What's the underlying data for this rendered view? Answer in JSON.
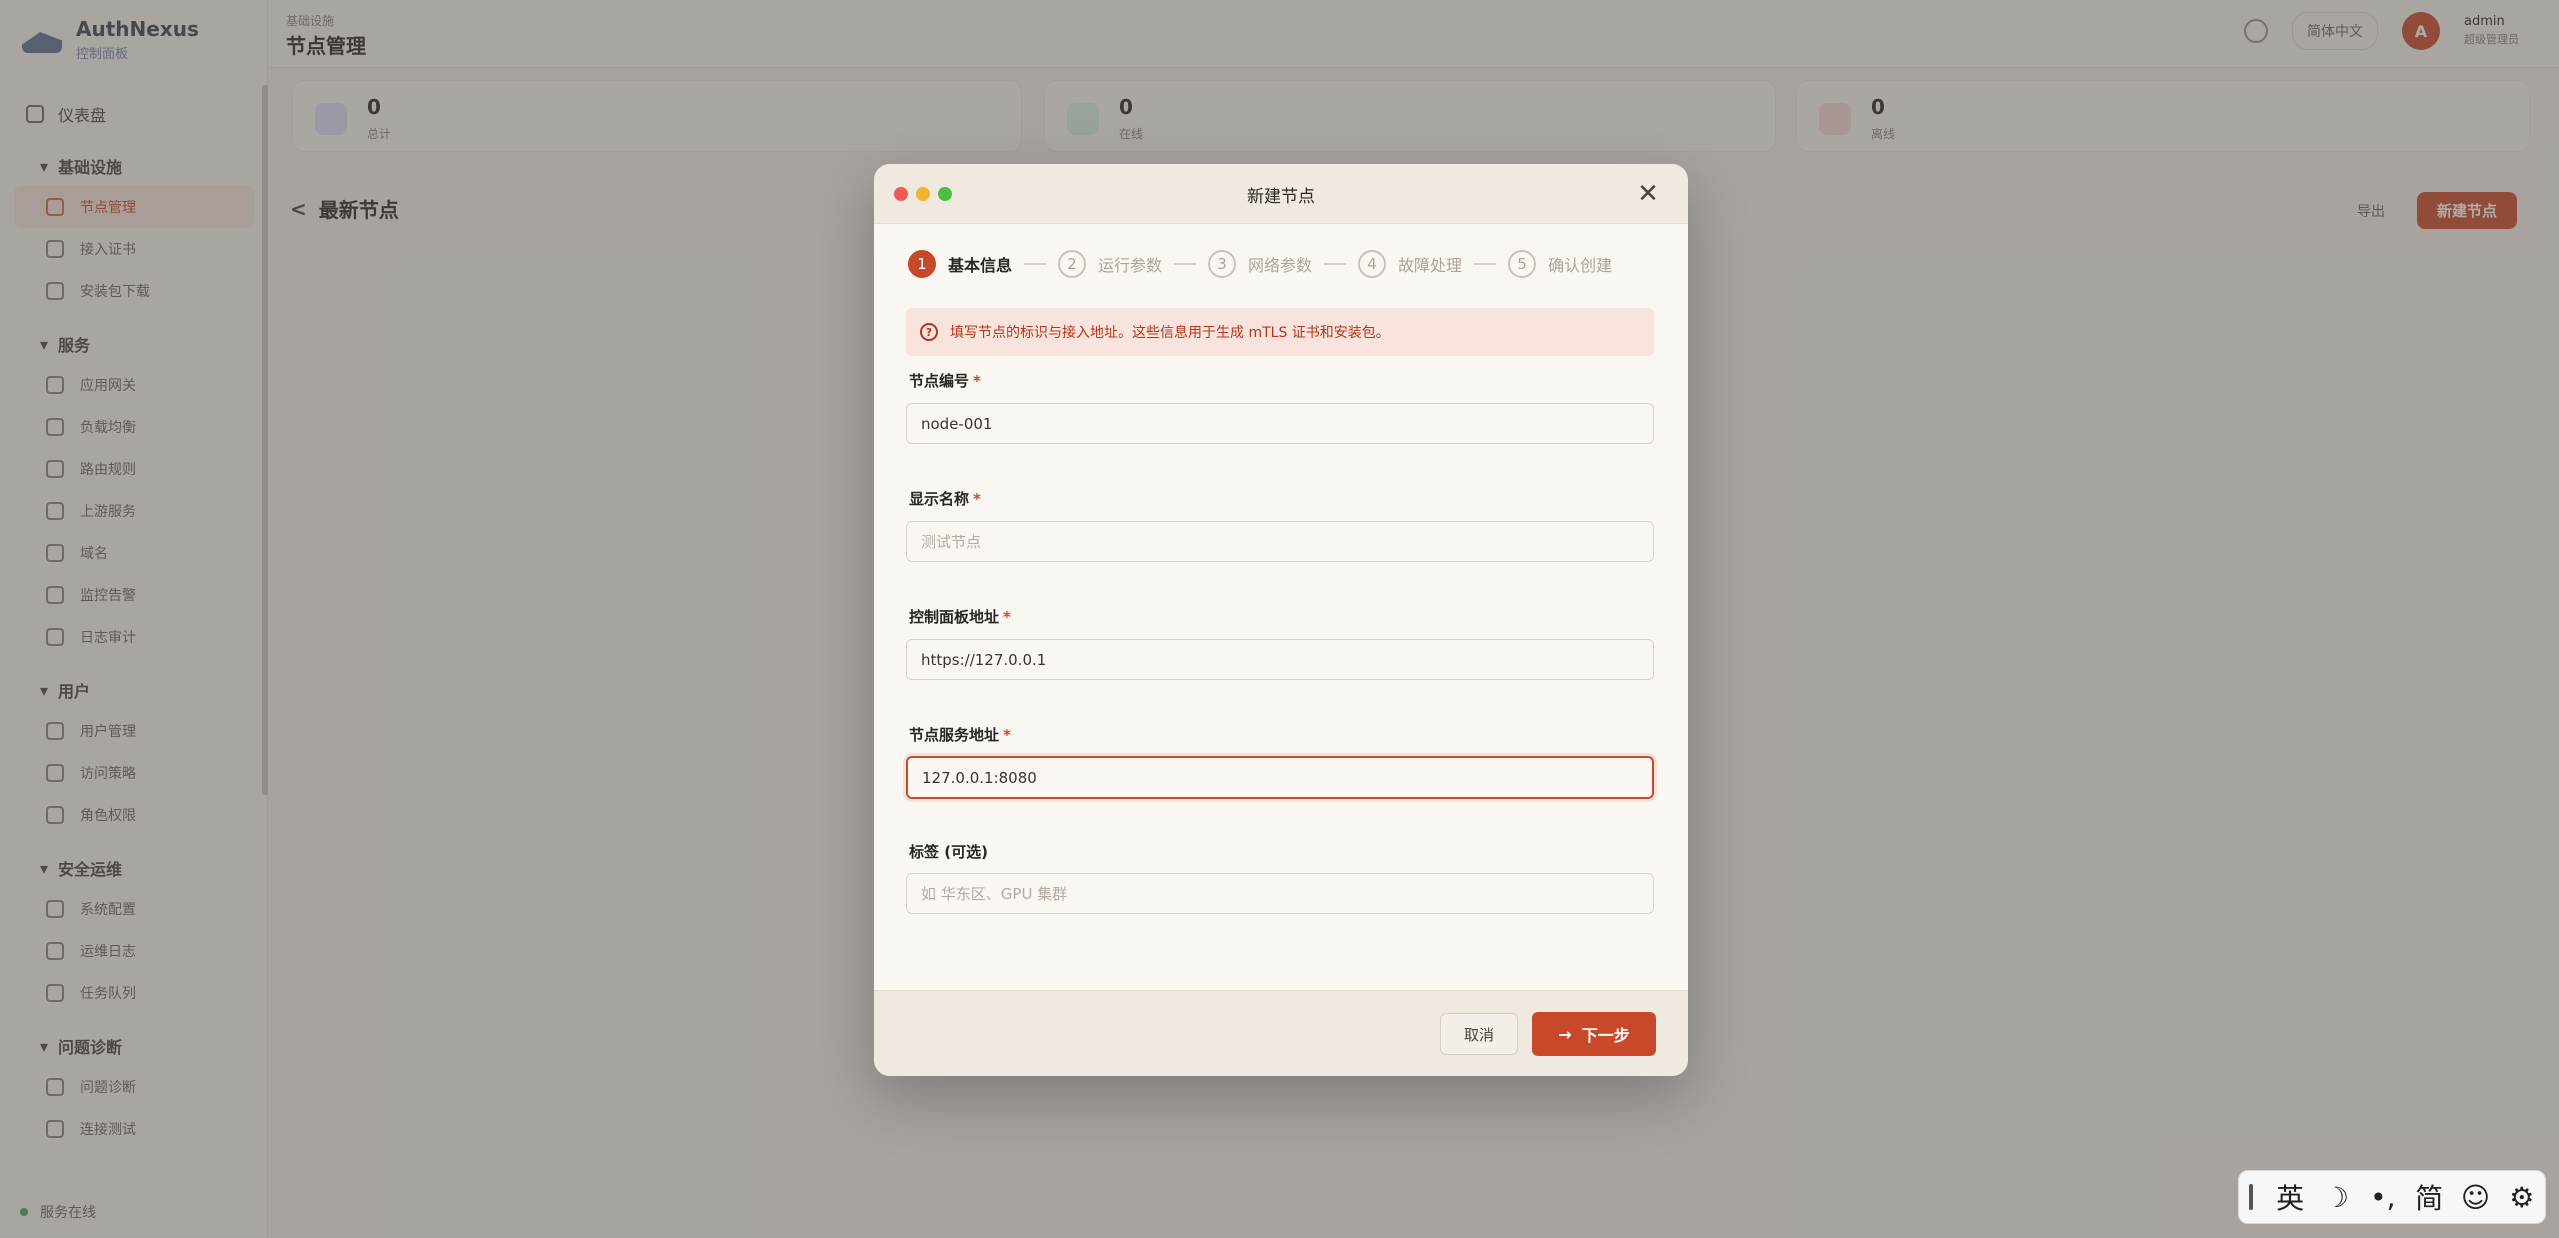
{
  "app": {
    "brand_title": "AuthNexus",
    "brand_sub": "控制面板"
  },
  "sidebar": {
    "top": {
      "label": "仪表盘"
    },
    "groups": [
      {
        "label": "基础设施",
        "items": [
          {
            "label": "节点管理",
            "active": true
          },
          {
            "label": "接入证书"
          },
          {
            "label": "安装包下载"
          }
        ]
      },
      {
        "label": "服务",
        "items": [
          {
            "label": "应用网关"
          },
          {
            "label": "负载均衡"
          },
          {
            "label": "路由规则"
          },
          {
            "label": "上游服务"
          },
          {
            "label": "域名"
          },
          {
            "label": "监控告警"
          },
          {
            "label": "日志审计"
          }
        ]
      },
      {
        "label": "用户",
        "items": [
          {
            "label": "用户管理"
          },
          {
            "label": "访问策略"
          },
          {
            "label": "角色权限"
          }
        ]
      },
      {
        "label": "安全运维",
        "items": [
          {
            "label": "系统配置"
          },
          {
            "label": "运维日志"
          },
          {
            "label": "任务队列"
          }
        ]
      },
      {
        "label": "问题诊断",
        "items": [
          {
            "label": "问题诊断"
          },
          {
            "label": "连接测试"
          }
        ]
      }
    ],
    "footer_status": "服务在线"
  },
  "topbar": {
    "crumb_small": "基础设施",
    "title": "节点管理",
    "lang": "简体中文",
    "avatar_letter": "A",
    "user_name": "admin",
    "user_role": "超级管理员"
  },
  "stats": [
    {
      "value": "0",
      "label": "总计",
      "color": "#6b6fd4"
    },
    {
      "value": "0",
      "label": "在线",
      "color": "#5db88a"
    },
    {
      "value": "0",
      "label": "离线",
      "color": "#d55a5a"
    }
  ],
  "section": {
    "title": "最新节点",
    "ghost_action": "导出",
    "primary_action": "新建节点"
  },
  "modal": {
    "title": "新建节点",
    "steps": [
      {
        "num": "1",
        "label": "基本信息",
        "active": true
      },
      {
        "num": "2",
        "label": "运行参数"
      },
      {
        "num": "3",
        "label": "网络参数"
      },
      {
        "num": "4",
        "label": "故障处理"
      },
      {
        "num": "5",
        "label": "确认创建"
      }
    ],
    "alert": "填写节点的标识与接入地址。这些信息用于生成 mTLS 证书和安装包。",
    "fields": {
      "node_id": {
        "label": "节点编号",
        "required": "*",
        "value": "node-001",
        "placeholder": ""
      },
      "display_name": {
        "label": "显示名称",
        "required": "*",
        "value": "",
        "placeholder": "测试节点"
      },
      "panel_url": {
        "label": "控制面板地址",
        "required": "*",
        "value": "https://127.0.0.1",
        "placeholder": ""
      },
      "service_addr": {
        "label": "节点服务地址",
        "required": "*",
        "value": "127.0.0.1:8080",
        "placeholder": ""
      },
      "tags": {
        "label": "标签 (可选)",
        "value": "",
        "placeholder": "如 华东区、GPU 集群"
      }
    },
    "cancel_label": "取消",
    "next_label": "下一步"
  },
  "ime": {
    "lang": "英",
    "moon": "☽",
    "punct": "•,",
    "simplified": "简",
    "emoji": "☺",
    "settings": "⚙"
  },
  "colors": {
    "accent": "#c8492a",
    "alert_bg": "#f8e4dc",
    "modal_bg": "#faf7f2"
  }
}
